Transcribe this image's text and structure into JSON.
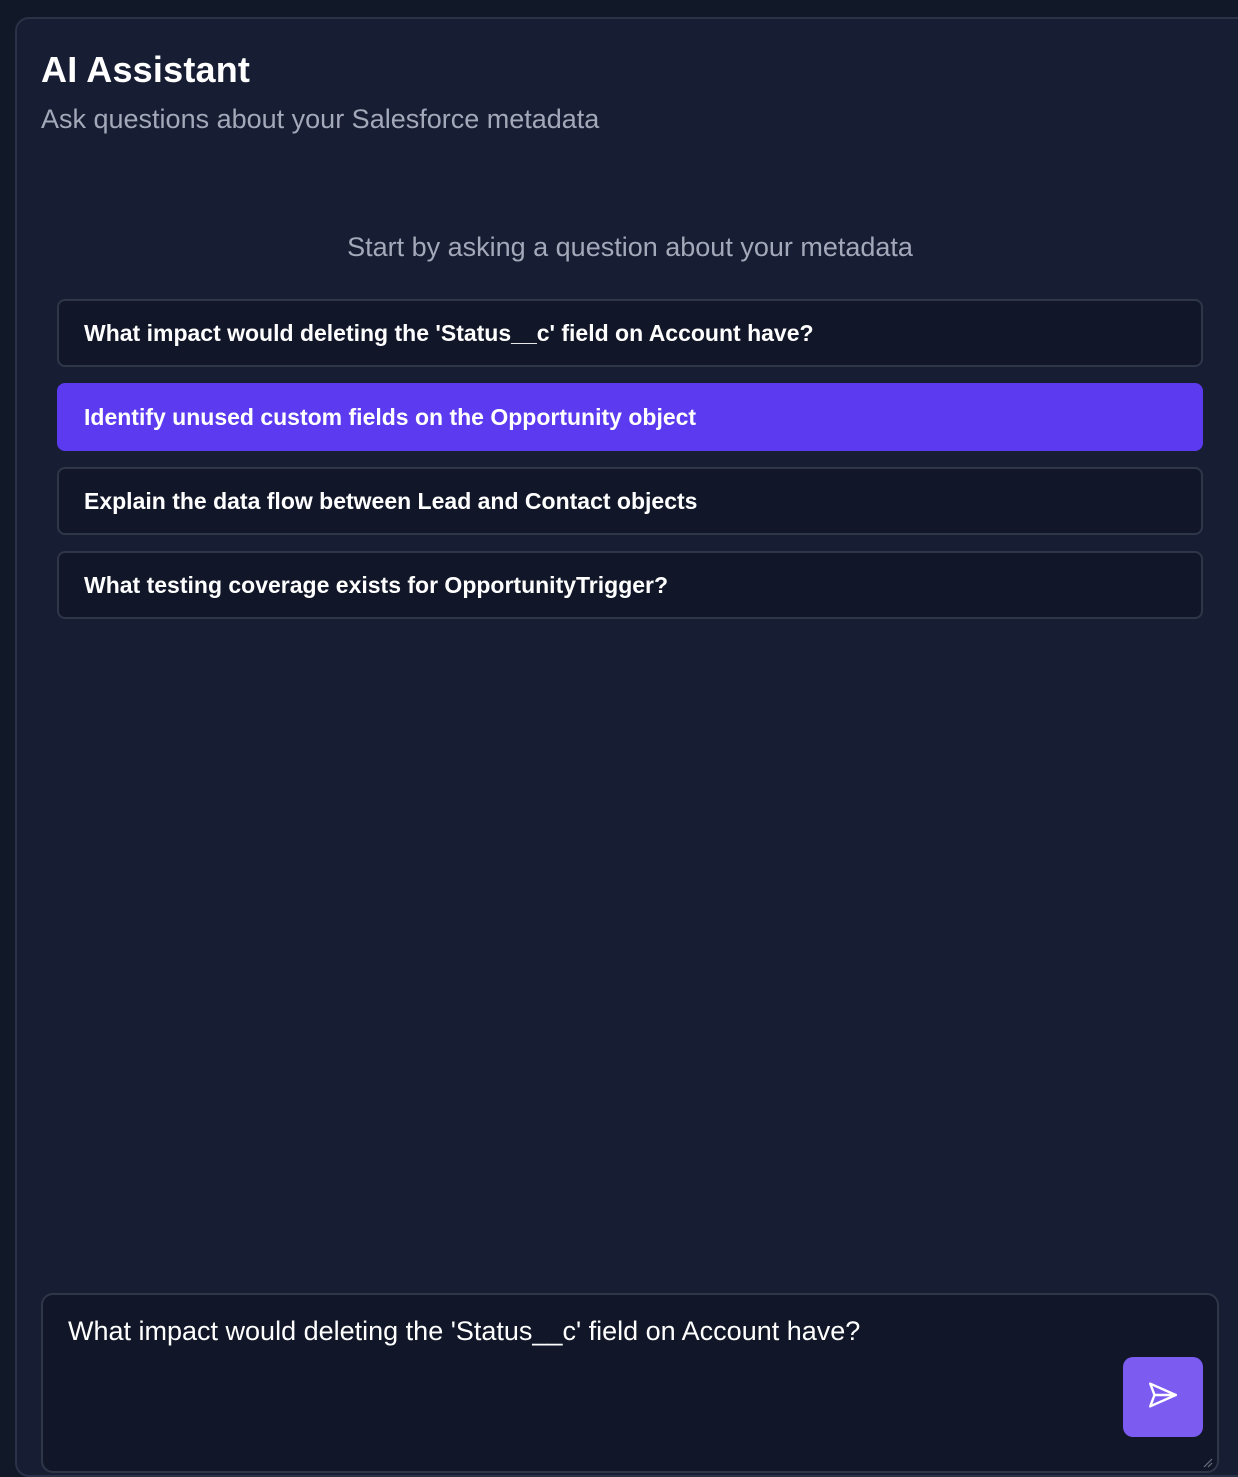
{
  "header": {
    "title": "AI Assistant",
    "subtitle": "Ask questions about your Salesforce metadata"
  },
  "empty_state": {
    "prompt": "Start by asking a question about your metadata"
  },
  "suggestions": [
    {
      "label": "What impact would deleting the 'Status__c' field on Account have?",
      "active": false
    },
    {
      "label": "Identify unused custom fields on the Opportunity object",
      "active": true
    },
    {
      "label": "Explain the data flow between Lead and Contact objects",
      "active": false
    },
    {
      "label": "What testing coverage exists for OpportunityTrigger?",
      "active": false
    }
  ],
  "composer": {
    "value": "What impact would deleting the 'Status__c' field on Account have?",
    "send_icon": "send-icon"
  },
  "colors": {
    "background": "#111827",
    "panel": "#171d33",
    "accent": "#5b3aef",
    "send_button": "#7c5cf0"
  }
}
